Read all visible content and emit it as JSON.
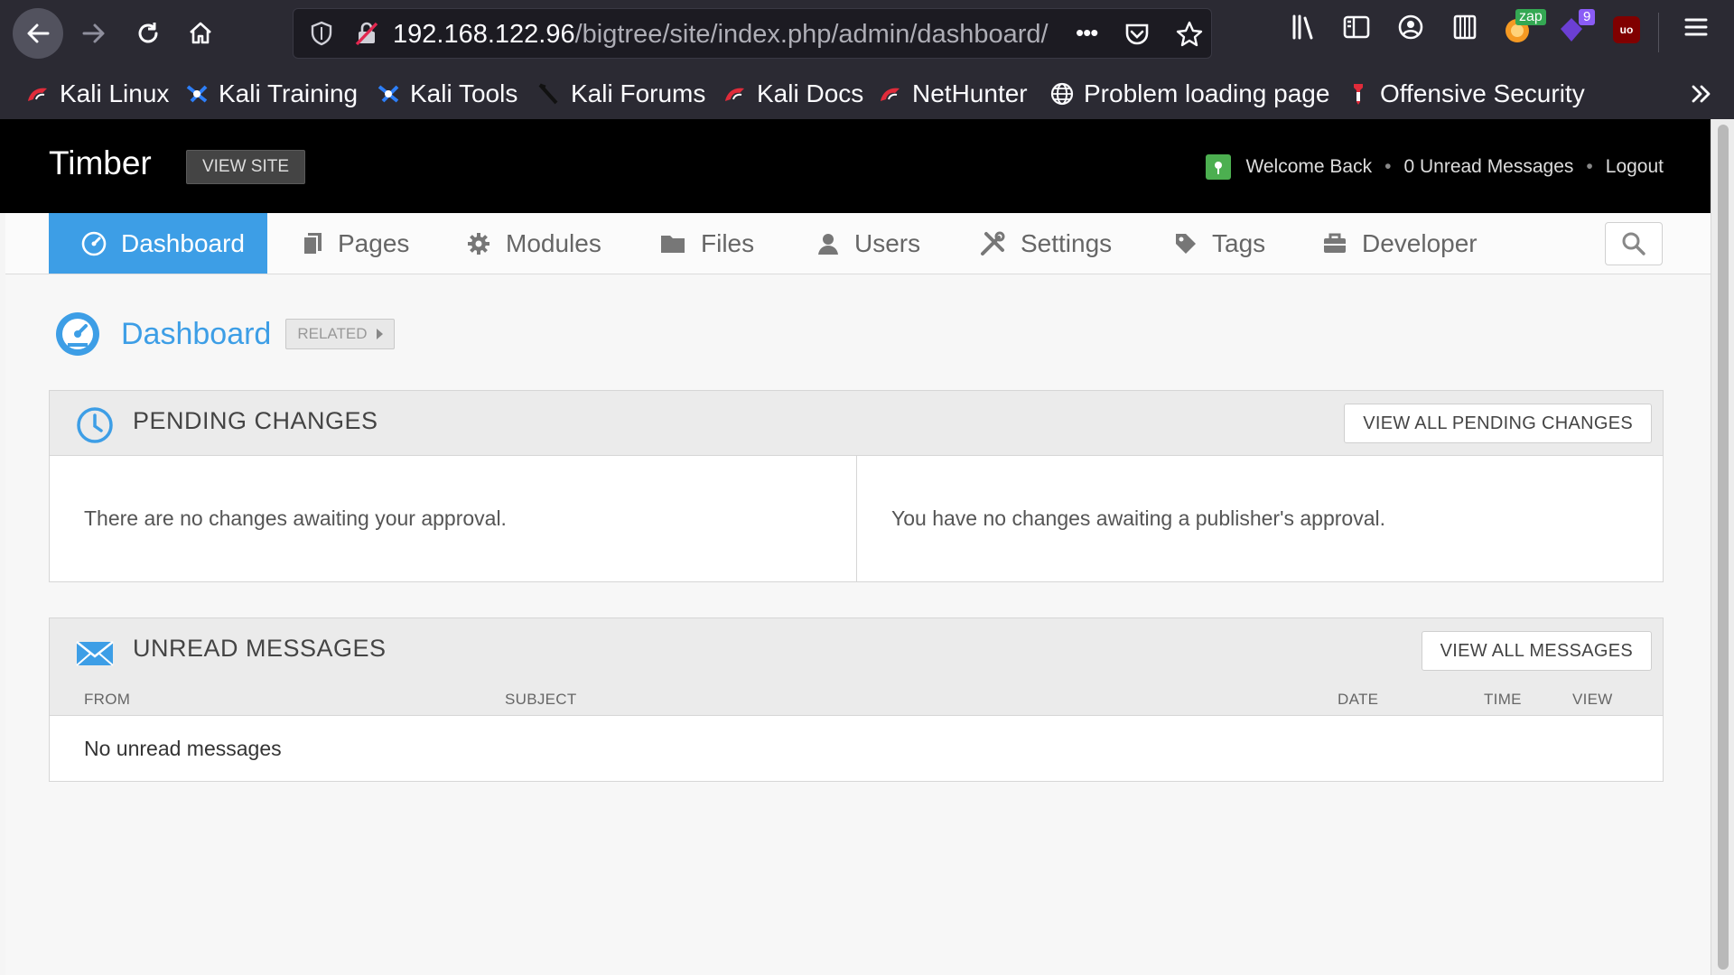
{
  "browser": {
    "url_host": "192.168.122.96",
    "url_path": "/bigtree/site/index.php/admin/dashboard/",
    "menu_dots": "•••",
    "bookmarks": [
      {
        "label": "Kali Linux",
        "icon": "kali-dragon-icon"
      },
      {
        "label": "Kali Training",
        "icon": "kali-training-icon"
      },
      {
        "label": "Kali Tools",
        "icon": "kali-tools-icon"
      },
      {
        "label": "Kali Forums",
        "icon": "kali-forums-icon"
      },
      {
        "label": "Kali Docs",
        "icon": "kali-dragon-icon"
      },
      {
        "label": "NetHunter",
        "icon": "kali-dragon-icon"
      },
      {
        "label": "Problem loading page",
        "icon": "globe-icon"
      },
      {
        "label": "Offensive Security",
        "icon": "offsec-icon"
      }
    ],
    "ext_badges": {
      "zap": "zap",
      "count": "9",
      "ublock": "uo"
    }
  },
  "header": {
    "site_title": "Timber",
    "view_site": "VIEW SITE",
    "welcome": "Welcome Back",
    "unread": "0 Unread Messages",
    "logout": "Logout"
  },
  "nav": {
    "items": [
      {
        "label": "Dashboard",
        "icon": "gauge-icon",
        "active": true
      },
      {
        "label": "Pages",
        "icon": "pages-icon"
      },
      {
        "label": "Modules",
        "icon": "gear-icon"
      },
      {
        "label": "Files",
        "icon": "folder-icon"
      },
      {
        "label": "Users",
        "icon": "user-icon"
      },
      {
        "label": "Settings",
        "icon": "tools-icon"
      },
      {
        "label": "Tags",
        "icon": "tag-icon"
      },
      {
        "label": "Developer",
        "icon": "briefcase-icon"
      }
    ]
  },
  "page": {
    "title": "Dashboard",
    "related": "RELATED"
  },
  "pending": {
    "title": "PENDING CHANGES",
    "button": "VIEW ALL PENDING CHANGES",
    "left_text": "There are no changes awaiting your approval.",
    "right_text": "You have no changes awaiting a publisher's approval."
  },
  "messages": {
    "title": "UNREAD MESSAGES",
    "button": "VIEW ALL MESSAGES",
    "columns": [
      "FROM",
      "SUBJECT",
      "DATE",
      "TIME",
      "VIEW"
    ],
    "empty": "No unread messages"
  },
  "colors": {
    "accent": "#3d9ee6",
    "chrome": "#2b2a33",
    "header": "#000000"
  }
}
